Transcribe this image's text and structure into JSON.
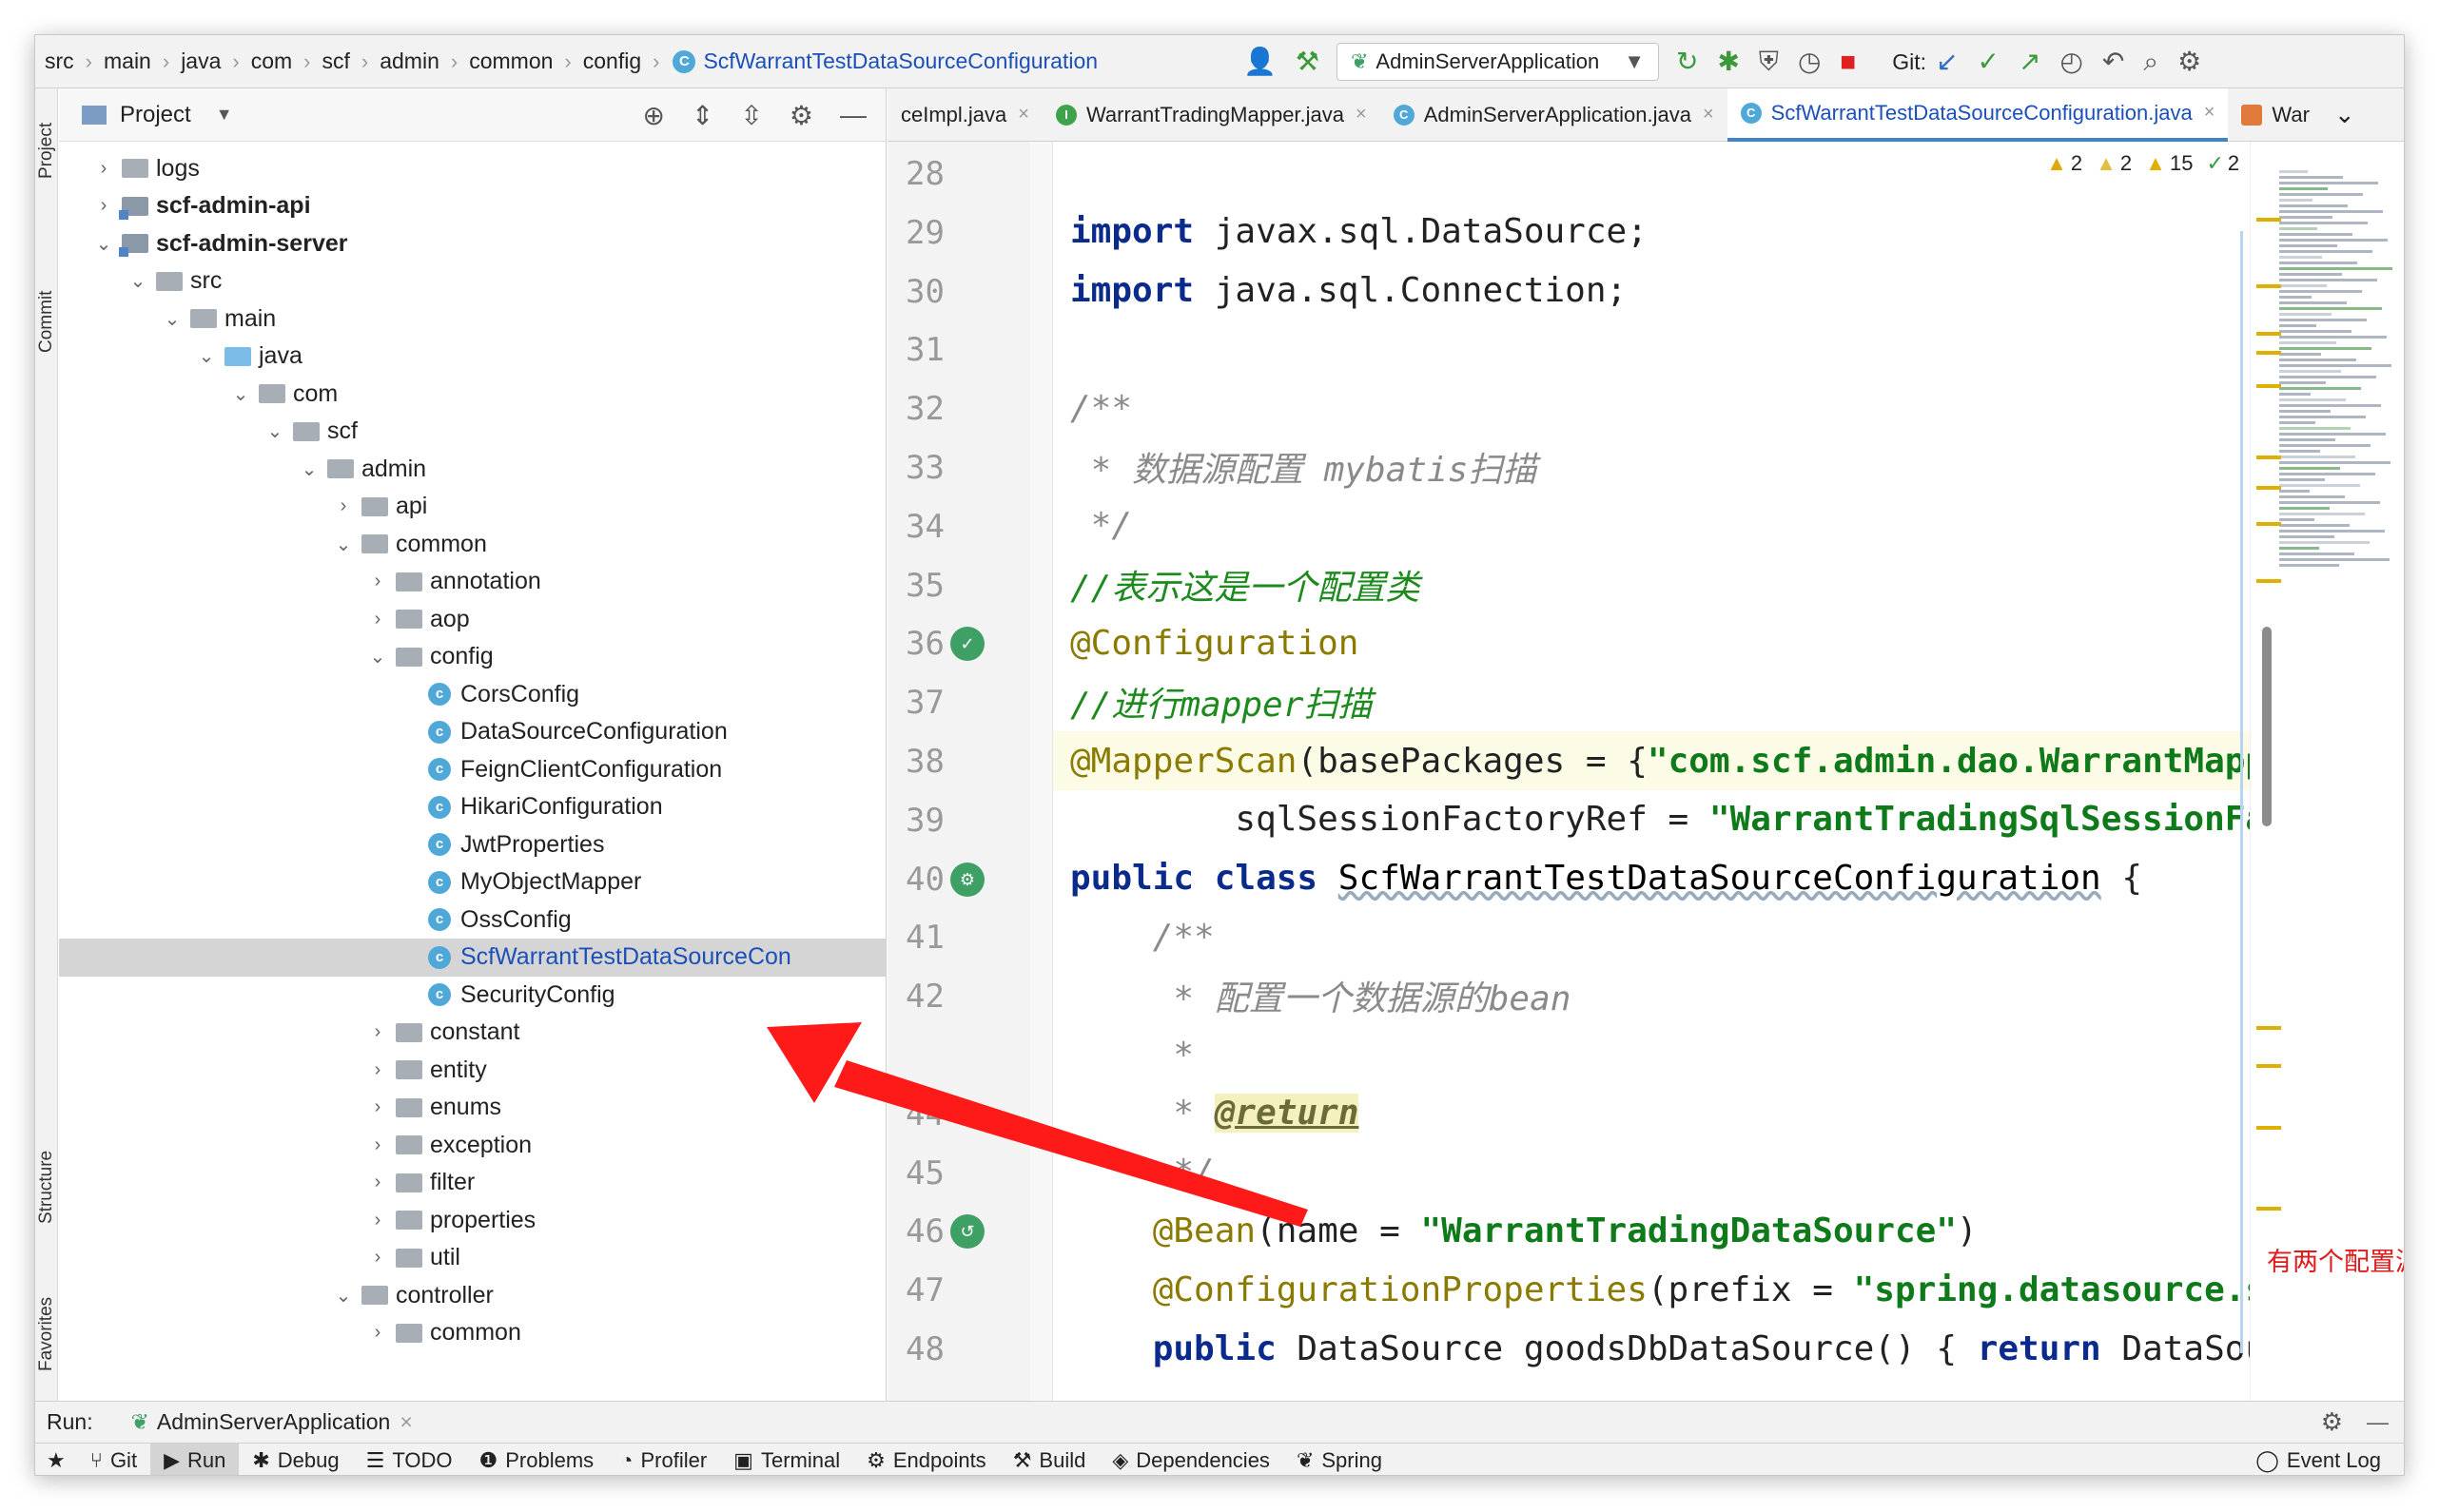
{
  "breadcrumb": [
    "src",
    "main",
    "java",
    "com",
    "scf",
    "admin",
    "common",
    "config",
    "ScfWarrantTestDataSourceConfiguration"
  ],
  "toolbar": {
    "run_config": "AdminServerApplication",
    "git_label": "Git:"
  },
  "left_tabs": {
    "project": "Project",
    "commit": "Commit",
    "structure": "Structure",
    "favorites": "Favorites"
  },
  "project_panel": {
    "title": "Project"
  },
  "tree": [
    {
      "label": "logs",
      "depth": 0,
      "arrow": "›",
      "icon": "folder"
    },
    {
      "label": "scf-admin-api",
      "depth": 0,
      "arrow": "›",
      "icon": "module",
      "bold": true
    },
    {
      "label": "scf-admin-server",
      "depth": 0,
      "arrow": "⌄",
      "icon": "module",
      "bold": true
    },
    {
      "label": "src",
      "depth": 1,
      "arrow": "⌄",
      "icon": "folder"
    },
    {
      "label": "main",
      "depth": 2,
      "arrow": "⌄",
      "icon": "folder"
    },
    {
      "label": "java",
      "depth": 3,
      "arrow": "⌄",
      "icon": "folder-blue"
    },
    {
      "label": "com",
      "depth": 4,
      "arrow": "⌄",
      "icon": "folder"
    },
    {
      "label": "scf",
      "depth": 5,
      "arrow": "⌄",
      "icon": "folder"
    },
    {
      "label": "admin",
      "depth": 6,
      "arrow": "⌄",
      "icon": "folder"
    },
    {
      "label": "api",
      "depth": 7,
      "arrow": "›",
      "icon": "folder"
    },
    {
      "label": "common",
      "depth": 7,
      "arrow": "⌄",
      "icon": "folder"
    },
    {
      "label": "annotation",
      "depth": 8,
      "arrow": "›",
      "icon": "folder"
    },
    {
      "label": "aop",
      "depth": 8,
      "arrow": "›",
      "icon": "folder"
    },
    {
      "label": "config",
      "depth": 8,
      "arrow": "⌄",
      "icon": "folder"
    },
    {
      "label": "CorsConfig",
      "depth": 9,
      "arrow": "",
      "icon": "class"
    },
    {
      "label": "DataSourceConfiguration",
      "depth": 9,
      "arrow": "",
      "icon": "class"
    },
    {
      "label": "FeignClientConfiguration",
      "depth": 9,
      "arrow": "",
      "icon": "class"
    },
    {
      "label": "HikariConfiguration",
      "depth": 9,
      "arrow": "",
      "icon": "class"
    },
    {
      "label": "JwtProperties",
      "depth": 9,
      "arrow": "",
      "icon": "class"
    },
    {
      "label": "MyObjectMapper",
      "depth": 9,
      "arrow": "",
      "icon": "class"
    },
    {
      "label": "OssConfig",
      "depth": 9,
      "arrow": "",
      "icon": "class"
    },
    {
      "label": "ScfWarrantTestDataSourceCon",
      "depth": 9,
      "arrow": "",
      "icon": "class",
      "selected": true
    },
    {
      "label": "SecurityConfig",
      "depth": 9,
      "arrow": "",
      "icon": "class"
    },
    {
      "label": "constant",
      "depth": 8,
      "arrow": "›",
      "icon": "folder"
    },
    {
      "label": "entity",
      "depth": 8,
      "arrow": "›",
      "icon": "folder"
    },
    {
      "label": "enums",
      "depth": 8,
      "arrow": "›",
      "icon": "folder"
    },
    {
      "label": "exception",
      "depth": 8,
      "arrow": "›",
      "icon": "folder"
    },
    {
      "label": "filter",
      "depth": 8,
      "arrow": "›",
      "icon": "folder"
    },
    {
      "label": "properties",
      "depth": 8,
      "arrow": "›",
      "icon": "folder"
    },
    {
      "label": "util",
      "depth": 8,
      "arrow": "›",
      "icon": "folder"
    },
    {
      "label": "controller",
      "depth": 7,
      "arrow": "⌄",
      "icon": "folder"
    },
    {
      "label": "common",
      "depth": 8,
      "arrow": "›",
      "icon": "folder"
    }
  ],
  "tabs": [
    {
      "label": "ceImpl.java",
      "icon": "",
      "color": "#4fa8d8",
      "active": false
    },
    {
      "label": "WarrantTradingMapper.java",
      "icon": "I",
      "color": "#3fa34d",
      "active": false
    },
    {
      "label": "AdminServerApplication.java",
      "icon": "C",
      "color": "#4fa8d8",
      "active": false
    },
    {
      "label": "ScfWarrantTestDataSourceConfiguration.java",
      "icon": "C",
      "color": "#4fa8d8",
      "active": true
    },
    {
      "label": "War",
      "icon": "",
      "color": "#e07a3a",
      "active": false
    }
  ],
  "inspections": {
    "errors": "2",
    "warnings": "2",
    "weak": "15",
    "ok": "2"
  },
  "lines": [
    {
      "n": "28",
      "segs": []
    },
    {
      "n": "29",
      "segs": [
        {
          "c": "kw",
          "t": "import"
        },
        {
          "c": "",
          "t": " javax.sql.DataSource;"
        }
      ]
    },
    {
      "n": "30",
      "segs": [
        {
          "c": "kw",
          "t": "import"
        },
        {
          "c": "",
          "t": " java.sql.Connection;"
        }
      ]
    },
    {
      "n": "31",
      "segs": []
    },
    {
      "n": "32",
      "segs": [
        {
          "c": "cmt",
          "t": "/**"
        }
      ]
    },
    {
      "n": "33",
      "segs": [
        {
          "c": "cmt",
          "t": " * 数据源配置 mybatis扫描"
        }
      ]
    },
    {
      "n": "34",
      "segs": [
        {
          "c": "cmt",
          "t": " */"
        }
      ]
    },
    {
      "n": "35",
      "segs": [
        {
          "c": "cmtg",
          "t": "//表示这是一个配置类"
        }
      ]
    },
    {
      "n": "36",
      "segs": [
        {
          "c": "ann",
          "t": "@Configuration"
        }
      ]
    },
    {
      "n": "37",
      "segs": [
        {
          "c": "cmtg",
          "t": "//进行mapper扫描"
        }
      ]
    },
    {
      "n": "38",
      "segs": [
        {
          "c": "ann",
          "t": "@MapperScan"
        },
        {
          "c": "",
          "t": "(basePackages = {"
        },
        {
          "c": "str",
          "t": "\"com.scf.admin.dao.WarrantMapper\""
        },
        {
          "c": "",
          "t": "},"
        }
      ],
      "current": true
    },
    {
      "n": "39",
      "segs": [
        {
          "c": "",
          "t": "        sqlSessionFactoryRef = "
        },
        {
          "c": "str",
          "t": "\"WarrantTradingSqlSessionFactory\""
        }
      ]
    },
    {
      "n": "40",
      "segs": [
        {
          "c": "kw",
          "t": "public class"
        },
        {
          "c": "",
          "t": " "
        },
        {
          "c": "cname",
          "t": "ScfWarrantTestDataSourceConfiguration"
        },
        {
          "c": "",
          "t": " {"
        }
      ]
    },
    {
      "n": "41",
      "segs": [
        {
          "c": "cmt",
          "t": "    /**"
        }
      ]
    },
    {
      "n": "42",
      "segs": [
        {
          "c": "cmt",
          "t": "     * 配置一个数据源的bean"
        }
      ]
    },
    {
      "n": "",
      "segs": [
        {
          "c": "cmt",
          "t": "     *"
        }
      ]
    },
    {
      "n": "44",
      "segs": [
        {
          "c": "cmt",
          "t": "     * "
        },
        {
          "c": "tag",
          "t": "@return"
        }
      ]
    },
    {
      "n": "45",
      "segs": [
        {
          "c": "cmt",
          "t": "     */"
        }
      ]
    },
    {
      "n": "46",
      "segs": [
        {
          "c": "ann",
          "t": "    @Bean"
        },
        {
          "c": "",
          "t": "(name = "
        },
        {
          "c": "str",
          "t": "\"WarrantTradingDataSource\""
        },
        {
          "c": "",
          "t": ")"
        }
      ]
    },
    {
      "n": "47",
      "segs": [
        {
          "c": "ann",
          "t": "    @ConfigurationProperties"
        },
        {
          "c": "",
          "t": "(prefix = "
        },
        {
          "c": "str",
          "t": "\"spring.datasource.scf-warrant\""
        }
      ]
    },
    {
      "n": "48",
      "segs": [
        {
          "c": "kw",
          "t": "    public"
        },
        {
          "c": "",
          "t": " DataSource goodsDbDataSource() { "
        },
        {
          "c": "kw",
          "t": "return"
        },
        {
          "c": "",
          "t": " DataSourceBuilder"
        }
      ]
    }
  ],
  "annotation_note": "有两个配置源需要在这写两个配置文件，我这里只写了一个",
  "run_bar": {
    "label": "Run:",
    "config": "AdminServerApplication"
  },
  "bottom_tools": [
    {
      "label": "Git",
      "icon": "⑂"
    },
    {
      "label": "Run",
      "icon": "▶",
      "active": true
    },
    {
      "label": "Debug",
      "icon": "✱"
    },
    {
      "label": "TODO",
      "icon": "☰"
    },
    {
      "label": "Problems",
      "icon": "❶"
    },
    {
      "label": "Profiler",
      "icon": "◔"
    },
    {
      "label": "Terminal",
      "icon": "▣"
    },
    {
      "label": "Endpoints",
      "icon": "⚙"
    },
    {
      "label": "Build",
      "icon": "⚒"
    },
    {
      "label": "Dependencies",
      "icon": "◈"
    },
    {
      "label": "Spring",
      "icon": "❦"
    }
  ],
  "event_log": "Event Log",
  "colors": {
    "accent": "#4083c9",
    "annotation_red": "#e11b1b"
  }
}
